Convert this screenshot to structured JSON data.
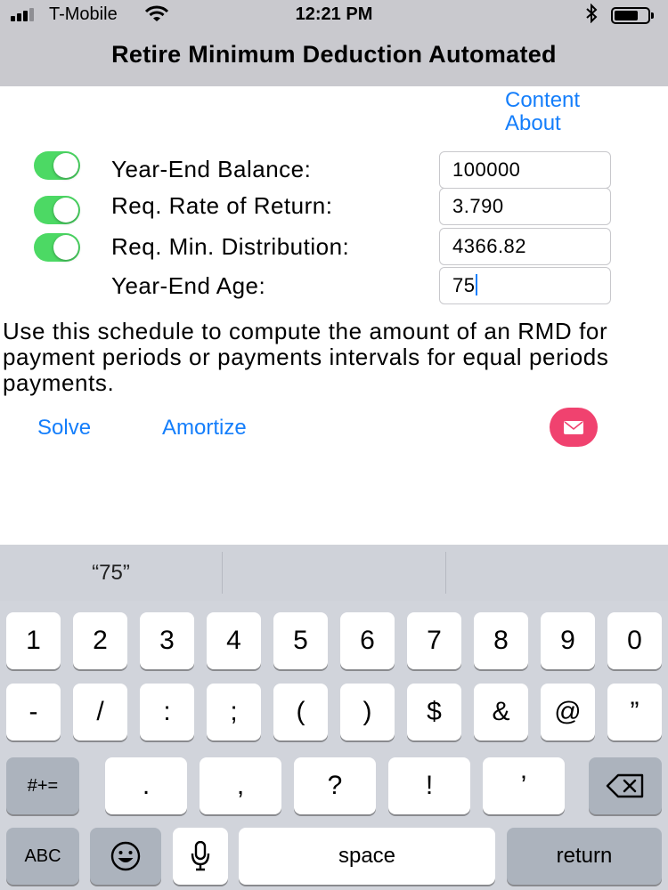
{
  "status": {
    "carrier": "T-Mobile",
    "time": "12:21 PM"
  },
  "nav": {
    "title": "Retire Minimum Deduction Automated"
  },
  "links": {
    "content": "Content",
    "about": "About"
  },
  "fields": [
    {
      "label": "Year-End Balance:",
      "value": "100000",
      "toggle": true
    },
    {
      "label": "Req. Rate of Return:",
      "value": "3.790",
      "toggle": true
    },
    {
      "label": "Req. Min. Distribution:",
      "value": "4366.82",
      "toggle": true
    },
    {
      "label": "Year-End Age:",
      "value": "75"
    }
  ],
  "description": "Use this schedule to compute the amount of an RMD for payment periods or payments intervals for equal periods payments.",
  "actions": {
    "solve": "Solve",
    "amortize": "Amortize",
    "mail_icon": "mail-icon"
  },
  "keyboard": {
    "suggestion": "“75”",
    "row1": [
      "1",
      "2",
      "3",
      "4",
      "5",
      "6",
      "7",
      "8",
      "9",
      "0"
    ],
    "row2": [
      "-",
      "/",
      ":",
      ";",
      "(",
      ")",
      "$",
      "&",
      "@",
      "”"
    ],
    "row3": [
      ".",
      ",",
      "?",
      "!",
      "’"
    ],
    "shift_label": "#+=",
    "abc_label": "ABC",
    "space_label": "space",
    "return_label": "return"
  },
  "colors": {
    "accent": "#147efb",
    "toggle_on": "#4cd964",
    "mail_button": "#f0426f",
    "nav_bg": "#c9c9ce",
    "keyboard_bg": "#d1d4db"
  }
}
